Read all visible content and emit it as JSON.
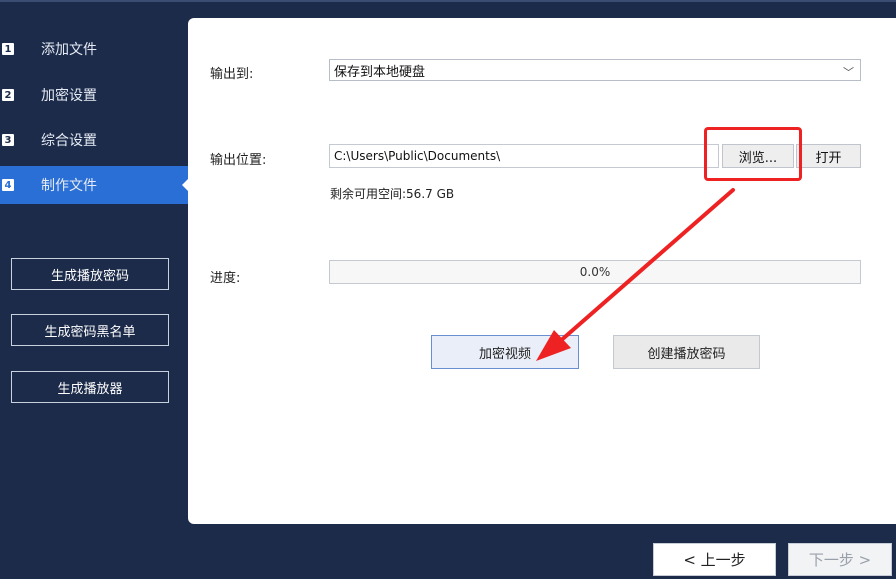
{
  "sidebar": {
    "steps": [
      {
        "num": "1",
        "label": "添加文件"
      },
      {
        "num": "2",
        "label": "加密设置"
      },
      {
        "num": "3",
        "label": "综合设置"
      },
      {
        "num": "4",
        "label": "制作文件"
      }
    ],
    "active_step": 4,
    "buttons": {
      "gen_password": "生成播放密码",
      "gen_blacklist": "生成密码黑名单",
      "gen_player": "生成播放器"
    }
  },
  "main": {
    "output_to_label": "输出到:",
    "output_to_value": "保存到本地硬盘",
    "output_location_label": "输出位置:",
    "output_location_value": "C:\\Users\\Public\\Documents\\",
    "browse_label": "浏览...",
    "open_label": "打开",
    "free_space_text": "剩余可用空间:56.7 GB",
    "progress_label": "进度:",
    "progress_value": 0.0,
    "progress_text": "0.0%",
    "encrypt_button": "加密视频",
    "create_password_button": "创建播放密码"
  },
  "nav": {
    "prev_label": "< 上一步",
    "next_label": "下一步 >"
  },
  "colors": {
    "background": "#1c2b4a",
    "active_step": "#2a6fd6",
    "annotation": "#ee2222"
  }
}
